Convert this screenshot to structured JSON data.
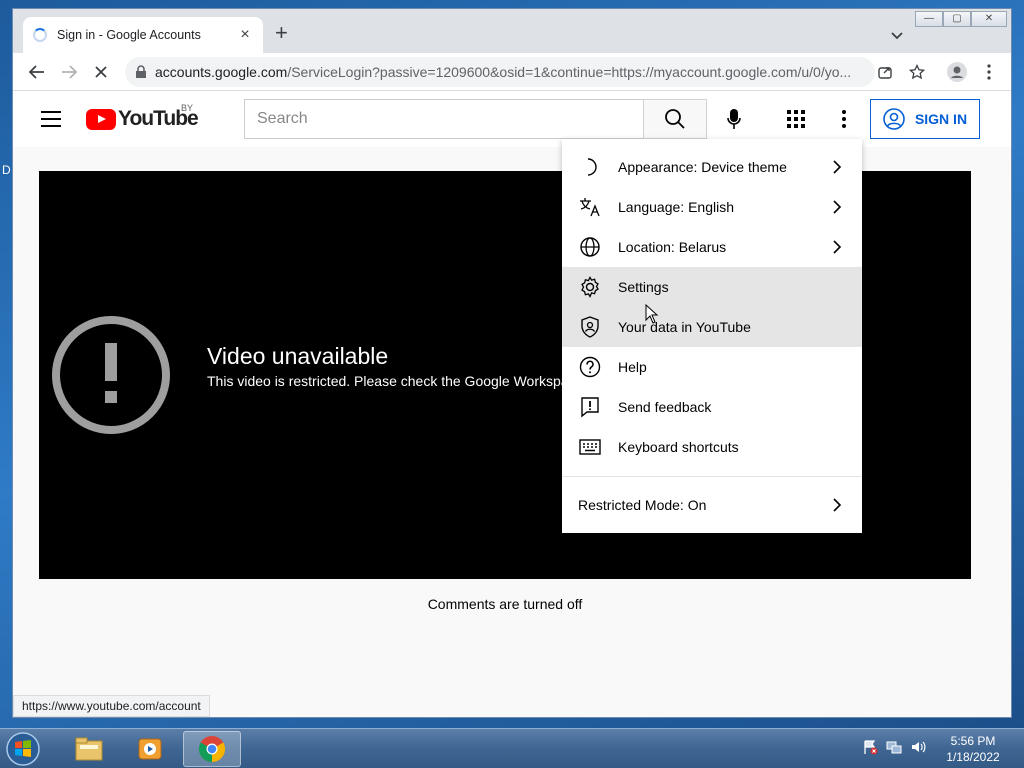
{
  "desktop": {
    "edge_letter": "D"
  },
  "browser": {
    "tab_title": "Sign in - Google Accounts",
    "new_tab": "+",
    "close_tab": "×",
    "url_host": "accounts.google.com",
    "url_rest": "/ServiceLogin?passive=1209600&osid=1&continue=https://myaccount.google.com/u/0/yo...",
    "window_controls": {
      "minimize": "—",
      "maximize": "▢",
      "close": "✕"
    }
  },
  "youtube": {
    "logo_text": "YouTube",
    "country_code": "BY",
    "search_placeholder": "Search",
    "signin_label": "SIGN IN",
    "error_title": "Video unavailable",
    "error_text": "This video is restricted. Please check the Google Workspace administrator restrictions.",
    "comments": "Comments are turned off",
    "status_url": "https://www.youtube.com/account"
  },
  "menu": {
    "items": [
      {
        "label": "Appearance: Device theme",
        "icon": "moon-icon",
        "chevron": true
      },
      {
        "label": "Language: English",
        "icon": "translate-icon",
        "chevron": true
      },
      {
        "label": "Location: Belarus",
        "icon": "globe-icon",
        "chevron": true
      },
      {
        "label": "Settings",
        "icon": "gear-icon",
        "chevron": false
      },
      {
        "label": "Your data in YouTube",
        "icon": "shield-user-icon",
        "chevron": false
      },
      {
        "label": "Help",
        "icon": "help-icon",
        "chevron": false
      },
      {
        "label": "Send feedback",
        "icon": "feedback-icon",
        "chevron": false
      },
      {
        "label": "Keyboard shortcuts",
        "icon": "keyboard-icon",
        "chevron": false
      }
    ],
    "restricted_mode": "Restricted Mode: On",
    "hovered_item": "Your data in YouTube"
  },
  "taskbar": {
    "time": "5:56 PM",
    "date": "1/18/2022",
    "items": [
      "explorer-icon",
      "media-player-icon",
      "chrome-icon"
    ]
  },
  "colors": {
    "youtube_red": "#ff0000",
    "signin_blue": "#065fd4",
    "menu_hover": "#e5e5e5"
  }
}
